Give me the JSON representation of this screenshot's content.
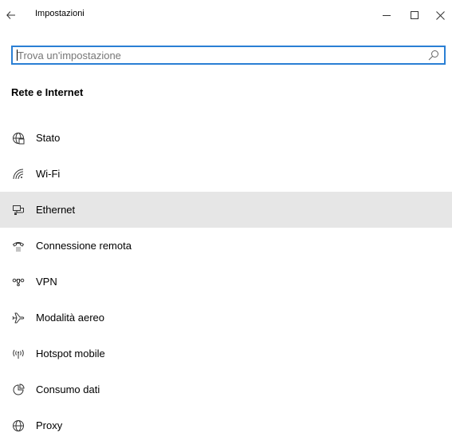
{
  "window": {
    "title": "Impostazioni",
    "controls": {
      "back_icon": "back-arrow-icon",
      "minimize_icon": "minimize-icon",
      "maximize_icon": "maximize-icon",
      "close_icon": "close-icon"
    }
  },
  "search": {
    "value": "",
    "placeholder": "Trova un'impostazione",
    "icon": "search-icon"
  },
  "section": {
    "title": "Rete e Internet"
  },
  "nav": {
    "items": [
      {
        "label": "Stato",
        "icon": "globe-status-icon",
        "selected": false
      },
      {
        "label": "Wi-Fi",
        "icon": "wifi-icon",
        "selected": false
      },
      {
        "label": "Ethernet",
        "icon": "ethernet-icon",
        "selected": true
      },
      {
        "label": "Connessione remota",
        "icon": "dialup-phone-icon",
        "selected": false
      },
      {
        "label": "VPN",
        "icon": "vpn-icon",
        "selected": false
      },
      {
        "label": "Modalità aereo",
        "icon": "airplane-icon",
        "selected": false
      },
      {
        "label": "Hotspot mobile",
        "icon": "hotspot-icon",
        "selected": false
      },
      {
        "label": "Consumo dati",
        "icon": "data-usage-icon",
        "selected": false
      },
      {
        "label": "Proxy",
        "icon": "globe-proxy-icon",
        "selected": false
      }
    ]
  },
  "colors": {
    "accent": "#2a7fd4",
    "selected_bg": "#e6e6e6",
    "placeholder": "#767676",
    "icon": "#333333"
  }
}
